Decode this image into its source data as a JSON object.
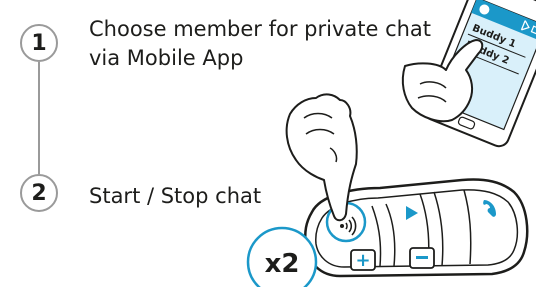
{
  "steps": [
    {
      "number": "1",
      "lines": [
        "Choose member for private chat",
        "via Mobile App"
      ]
    },
    {
      "number": "2",
      "lines": [
        "Start / Stop chat"
      ]
    }
  ],
  "phone": {
    "items": [
      "Buddy 1",
      "Buddy 2"
    ],
    "icons": [
      "app-logo-icon",
      "bluetooth-icon",
      "battery-icon"
    ]
  },
  "device": {
    "press_badge": "x2",
    "buttons": [
      "intercom-button",
      "play-button",
      "phone-button",
      "volume-up-button",
      "volume-down-button"
    ],
    "button_glyphs": {
      "plus": "+",
      "minus": "−"
    }
  },
  "colors": {
    "accent": "#1b98c9",
    "outline": "#1d1d1b",
    "connector": "#9a9a9a",
    "phone_screen": "#d9f0fa"
  }
}
